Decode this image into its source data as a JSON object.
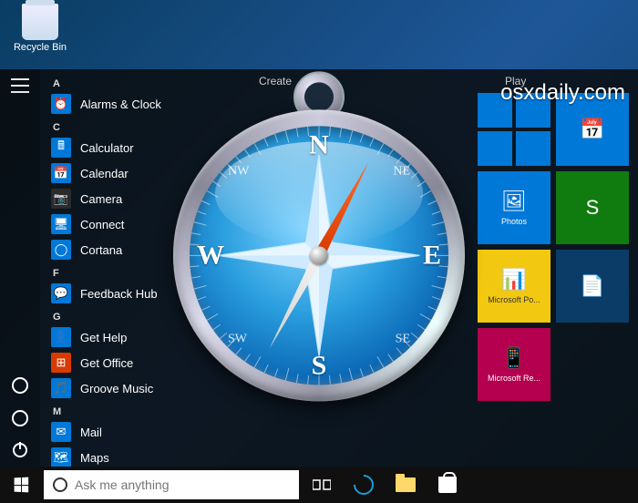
{
  "watermark": "osxdaily.com",
  "desktop": {
    "recycle_bin": "Recycle Bin"
  },
  "compass": {
    "n": "N",
    "e": "E",
    "s": "S",
    "w": "W",
    "ne": "NE",
    "nw": "NW",
    "se": "SE",
    "sw": "SW"
  },
  "start": {
    "headers": {
      "create": "Create",
      "play": "Play"
    },
    "groups": [
      {
        "letter": "A",
        "items": [
          {
            "label": "Alarms & Clock",
            "color": "blue",
            "glyph": "⏰"
          }
        ]
      },
      {
        "letter": "C",
        "items": [
          {
            "label": "Calculator",
            "color": "blue",
            "glyph": "🖩"
          },
          {
            "label": "Calendar",
            "color": "blue",
            "glyph": "📅"
          },
          {
            "label": "Camera",
            "color": "dark",
            "glyph": "📷"
          },
          {
            "label": "Connect",
            "color": "blue",
            "glyph": "🖥"
          },
          {
            "label": "Cortana",
            "color": "blue",
            "glyph": "◯"
          }
        ]
      },
      {
        "letter": "F",
        "items": [
          {
            "label": "Feedback Hub",
            "color": "blue",
            "glyph": "💬"
          }
        ]
      },
      {
        "letter": "G",
        "items": [
          {
            "label": "Get Help",
            "color": "blue",
            "glyph": "👤"
          },
          {
            "label": "Get Office",
            "color": "orange",
            "glyph": "⊞"
          },
          {
            "label": "Groove Music",
            "color": "blue",
            "glyph": "🎵"
          }
        ]
      },
      {
        "letter": "M",
        "items": [
          {
            "label": "Mail",
            "color": "blue",
            "glyph": "✉"
          },
          {
            "label": "Maps",
            "color": "blue",
            "glyph": "🗺"
          }
        ]
      }
    ],
    "tiles": [
      {
        "kind": "quad"
      },
      {
        "label": "",
        "color": "blue",
        "glyph": "📅"
      },
      {
        "label": "Photos",
        "color": "blue",
        "glyph": "🖼"
      },
      {
        "label": "",
        "color": "green",
        "glyph": "S"
      },
      {
        "label": "Microsoft Po...",
        "color": "yellow",
        "glyph": "📊"
      },
      {
        "label": "",
        "color": "navy",
        "glyph": "📄"
      },
      {
        "label": "Microsoft Re...",
        "color": "magenta",
        "glyph": "📱"
      }
    ]
  },
  "taskbar": {
    "search_placeholder": "Ask me anything"
  }
}
